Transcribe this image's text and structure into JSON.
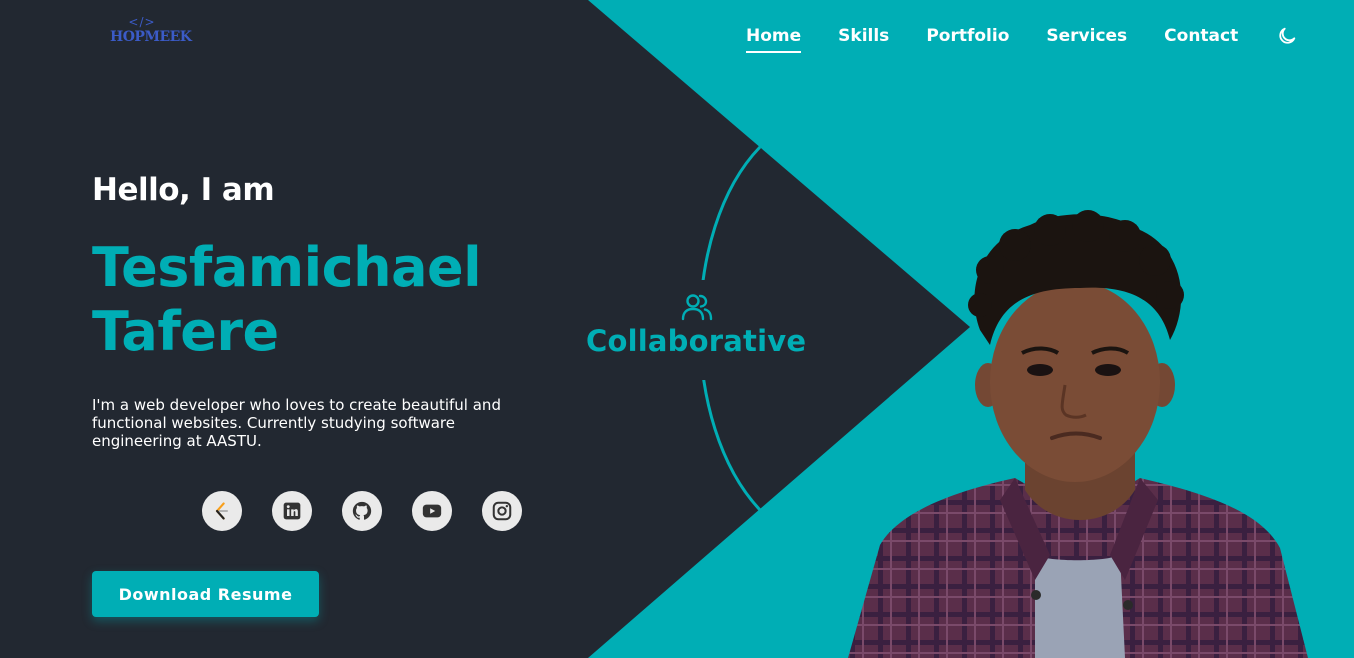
{
  "brand": {
    "logo_code": "</>",
    "logo_word": "HOPMEEK"
  },
  "nav": {
    "items": [
      {
        "label": "Home",
        "active": true
      },
      {
        "label": "Skills",
        "active": false
      },
      {
        "label": "Portfolio",
        "active": false
      },
      {
        "label": "Services",
        "active": false
      },
      {
        "label": "Contact",
        "active": false
      }
    ],
    "theme_icon": "moon-icon"
  },
  "hero": {
    "greeting": "Hello, I am",
    "name_line1": "Tesfamichael",
    "name_line2": "Tafere",
    "bio": "I'm a web developer who loves to create beautiful and functional websites. Currently studying software engineering at AASTU.",
    "cta_label": "Download Resume"
  },
  "socials": [
    {
      "name": "leetcode",
      "icon": "leetcode-icon"
    },
    {
      "name": "linkedin",
      "icon": "linkedin-icon"
    },
    {
      "name": "github",
      "icon": "github-icon"
    },
    {
      "name": "youtube",
      "icon": "youtube-icon"
    },
    {
      "name": "instagram",
      "icon": "instagram-icon"
    }
  ],
  "trait": {
    "label": "Collaborative",
    "icon": "users-icon"
  },
  "colors": {
    "dark": "#222831",
    "accent": "#00aeb5",
    "text": "#ffffff"
  }
}
